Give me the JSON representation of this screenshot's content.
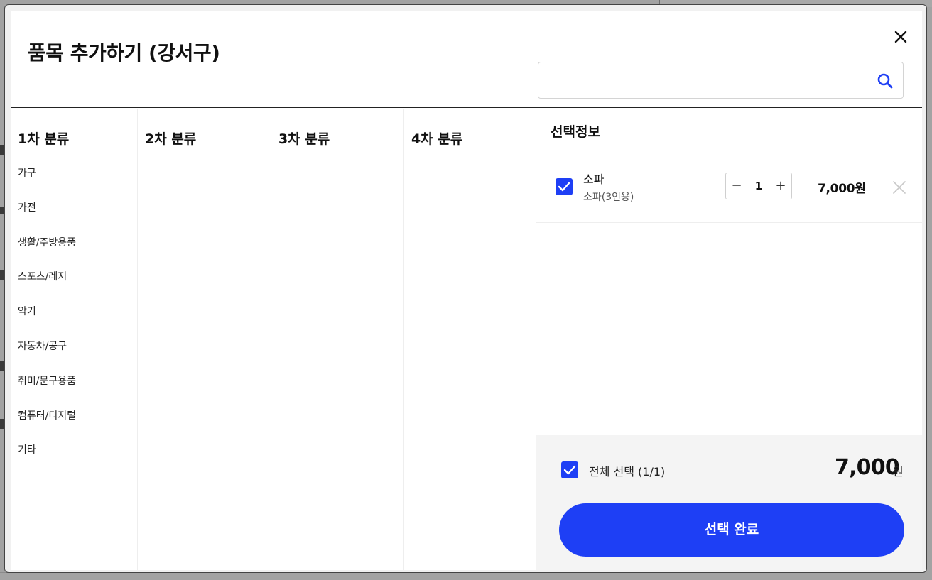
{
  "modal": {
    "title": "품목 추가하기 (강서구)",
    "search": {
      "value": "",
      "placeholder": ""
    }
  },
  "columns": [
    {
      "header": "1차 분류",
      "items": [
        "가구",
        "가전",
        "생활/주방용품",
        "스포츠/레저",
        "악기",
        "자동차/공구",
        "취미/문구용품",
        "컴퓨터/디지털",
        "기타"
      ]
    },
    {
      "header": "2차 분류",
      "items": []
    },
    {
      "header": "3차 분류",
      "items": []
    },
    {
      "header": "4차 분류",
      "items": []
    }
  ],
  "selection": {
    "title": "선택정보",
    "items": [
      {
        "checked": true,
        "name": "소파",
        "sub": "소파(3인용)",
        "quantity": "1",
        "minus": "−",
        "plus": "+",
        "price": "7,000원"
      }
    ],
    "select_all_label": "전체 선택 (1/1)",
    "total": "7,000",
    "total_unit": "원",
    "done_label": "선택 완료"
  },
  "colors": {
    "accent": "#1e3ff5",
    "footer_bg": "#f4f4f4"
  },
  "icons": {
    "close": "close-icon",
    "search": "search-icon",
    "check": "check-icon",
    "remove": "remove-icon"
  }
}
